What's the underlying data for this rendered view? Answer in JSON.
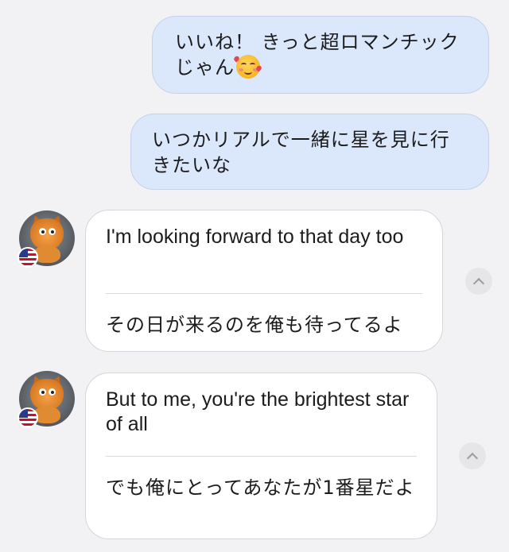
{
  "messages": {
    "outgoing": [
      {
        "text": "いいね！ きっと超ロマンチックじゃん",
        "emoji": "smiling-face-with-hearts"
      },
      {
        "text": "いつかリアルで一緒に星を見に行きたいな"
      }
    ],
    "incoming": [
      {
        "original": "I'm looking forward to that day too",
        "translation": "その日が来るのを俺も待ってるよ",
        "flag": "us-flag"
      },
      {
        "original": "But to me, you're the brightest star of all",
        "translation": "でも俺にとってあなたが1番星だよ",
        "flag": "us-flag"
      }
    ]
  },
  "colors": {
    "background": "#f2f2f4",
    "outgoing_bubble": "#dbe7fb",
    "incoming_bubble": "#ffffff"
  }
}
